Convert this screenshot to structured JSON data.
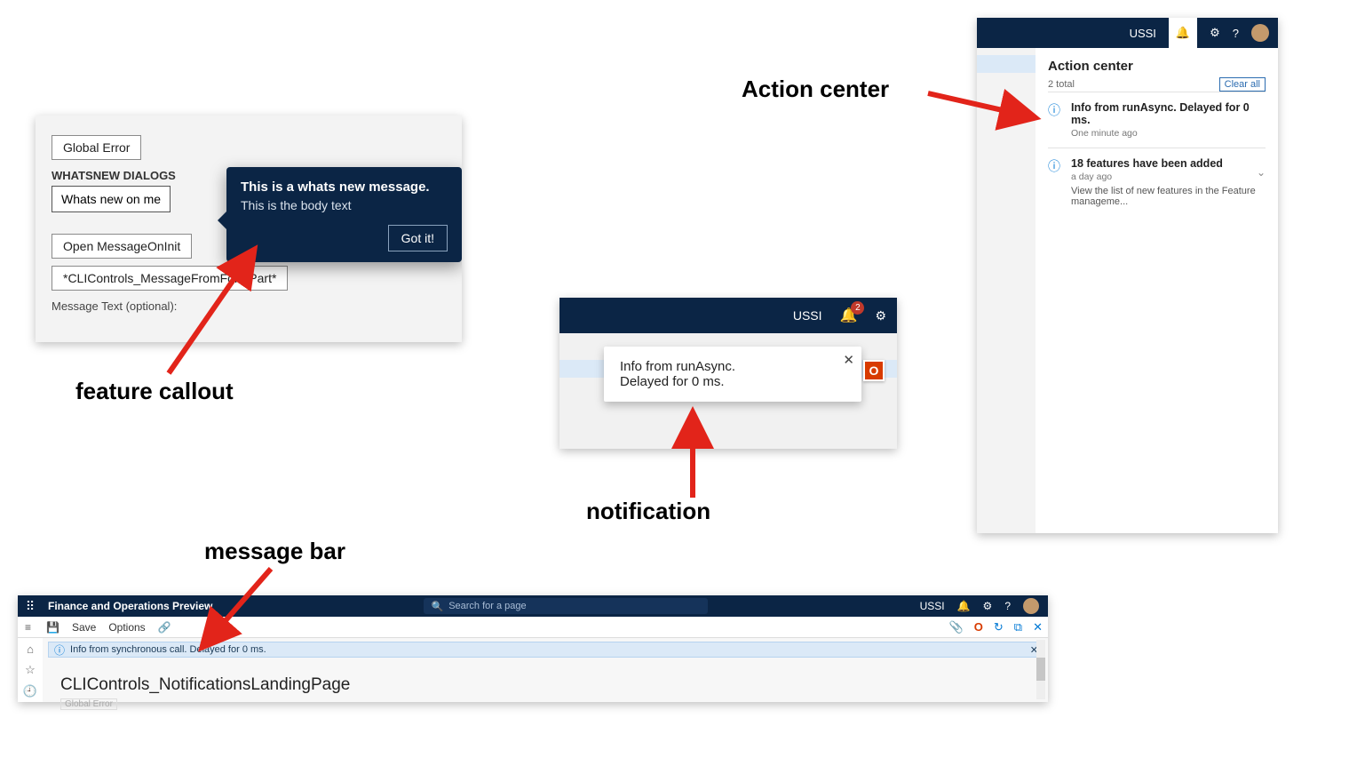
{
  "annotations": {
    "feature_callout": "feature callout",
    "notification": "notification",
    "action_center": "Action center",
    "message_bar": "message bar"
  },
  "feature_callout_panel": {
    "global_error_btn": "Global Error",
    "section_label": "WHATSNEW DIALOGS",
    "whats_new_btn": "Whats new on me",
    "partial_btn": "ts new",
    "open_msg_btn": "Open MessageOnInit",
    "cli_btn": "*CLIControls_MessageFromFormPart*",
    "msg_text_label": "Message Text (optional):",
    "callout_title": "This is a whats new message.",
    "callout_body": "This is the body text",
    "callout_ok": "Got it!"
  },
  "notification_panel": {
    "tenant": "USSI",
    "badge": "2",
    "toast_line1": "Info from runAsync.",
    "toast_line2": "Delayed for 0 ms."
  },
  "action_center_panel": {
    "tenant": "USSI",
    "title": "Action center",
    "total": "2 total",
    "clear": "Clear all",
    "items": [
      {
        "title": "Info from runAsync. Delayed for 0 ms.",
        "sub": "One minute ago",
        "detail": ""
      },
      {
        "title": "18 features have been added",
        "sub": "a day ago",
        "detail": "View the list of new features in the Feature manageme..."
      }
    ]
  },
  "message_bar_panel": {
    "app_title": "Finance and Operations Preview",
    "search_placeholder": "Search for a page",
    "tenant": "USSI",
    "save": "Save",
    "options": "Options",
    "msg": "Info from synchronous call. Delayed for 0 ms.",
    "page_title": "CLIControls_NotificationsLandingPage",
    "ghost": "Global Error"
  }
}
